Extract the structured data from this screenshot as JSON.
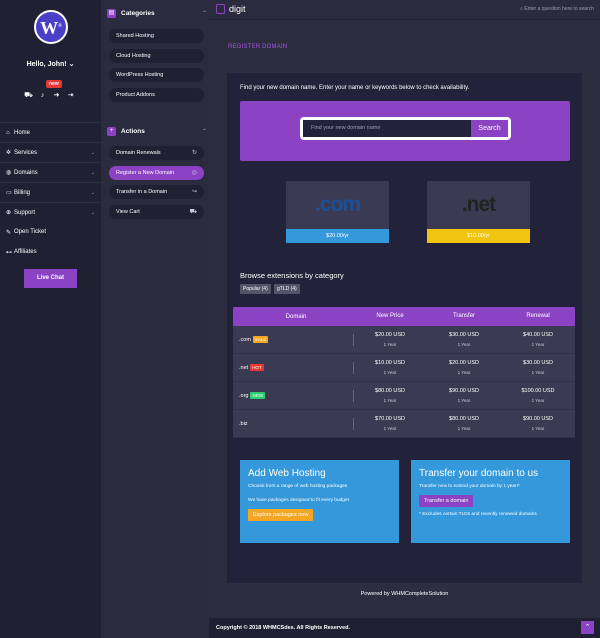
{
  "user": {
    "avatar_letter": "W",
    "greeting": "Hello, John!"
  },
  "header_icons": {
    "new_badge": "new"
  },
  "sidebar": {
    "items": [
      {
        "icon": "⌂",
        "label": "Home",
        "caret": ""
      },
      {
        "icon": "✲",
        "label": "Services",
        "caret": "⌄"
      },
      {
        "icon": "◍",
        "label": "Domains",
        "caret": "⌄"
      },
      {
        "icon": "▭",
        "label": "Billing",
        "caret": "⌄"
      },
      {
        "icon": "⊕",
        "label": "Support",
        "caret": "⌄"
      },
      {
        "icon": "✎",
        "label": "Open Ticket",
        "caret": ""
      },
      {
        "icon": "⊷",
        "label": "Affiliates",
        "caret": ""
      }
    ],
    "live_chat": "Live Chat"
  },
  "categories": {
    "title": "Categories",
    "items": [
      "Shared Hosting",
      "Cloud Hosting",
      "WordPress Hosting",
      "Product Addons"
    ]
  },
  "actions": {
    "title": "Actions",
    "items": [
      {
        "label": "Domain Renewals",
        "icon": "↻"
      },
      {
        "label": "Register a New Domain",
        "icon": "◎"
      },
      {
        "label": "Transfer in a Domain",
        "icon": "↪"
      },
      {
        "label": "View Cart",
        "icon": "⛟"
      }
    ]
  },
  "topbar": {
    "logo": "digit",
    "search_placeholder": "Enter a question here to search"
  },
  "page": {
    "title": "REGISTER DOMAIN",
    "intro": "Find your new domain name. Enter your name or keywords below to check availability.",
    "search_placeholder": "Find your new domain name",
    "search_button": "Search"
  },
  "tlds": [
    {
      "name": ".com",
      "price": "$20.00/yr",
      "color": "#3498db"
    },
    {
      "name": ".net",
      "price": "$10.00/yr",
      "color": "#f1c40f"
    }
  ],
  "browse": {
    "title": "Browse extensions by category",
    "tags": [
      "Popular (4)",
      "gTLD (4)"
    ]
  },
  "table": {
    "headers": [
      "Domain",
      "New Price",
      "Transfer",
      "Renewal"
    ],
    "rows": [
      {
        "tld": ".com",
        "badge": "SALE",
        "badge_color": "#f5a623",
        "new": "$20.00 USD",
        "transfer": "$30.00 USD",
        "renewal": "$40.00 USD",
        "term": "1 Year"
      },
      {
        "tld": ".net",
        "badge": "HOT",
        "badge_color": "#e53935",
        "new": "$10.00 USD",
        "transfer": "$20.00 USD",
        "renewal": "$30.00 USD",
        "term": "1 Year"
      },
      {
        "tld": ".org",
        "badge": "NEW",
        "badge_color": "#2ecc71",
        "new": "$80.00 USD",
        "transfer": "$90.00 USD",
        "renewal": "$100.00 USD",
        "term": "1 Year"
      },
      {
        "tld": ".biz",
        "badge": "",
        "badge_color": "",
        "new": "$70.00 USD",
        "transfer": "$80.00 USD",
        "renewal": "$90.00 USD",
        "term": "1 Year"
      }
    ]
  },
  "promo_hosting": {
    "title": "Add Web Hosting",
    "line1": "Choose from a range of web hosting packages",
    "line2": "We have packages designed to fit every budget",
    "button": "Explore packages now"
  },
  "promo_transfer": {
    "title": "Transfer your domain to us",
    "line1": "Transfer now to extend your domain by 1 year!*",
    "button": "Transfer a domain",
    "note": "* Excludes certain TLDs and recently renewed domains"
  },
  "powered": "Powered by WHMCompleteSolution",
  "footer": {
    "copyright": "Copyright © 2018 WHMCSdes. All Rights Reserved."
  }
}
